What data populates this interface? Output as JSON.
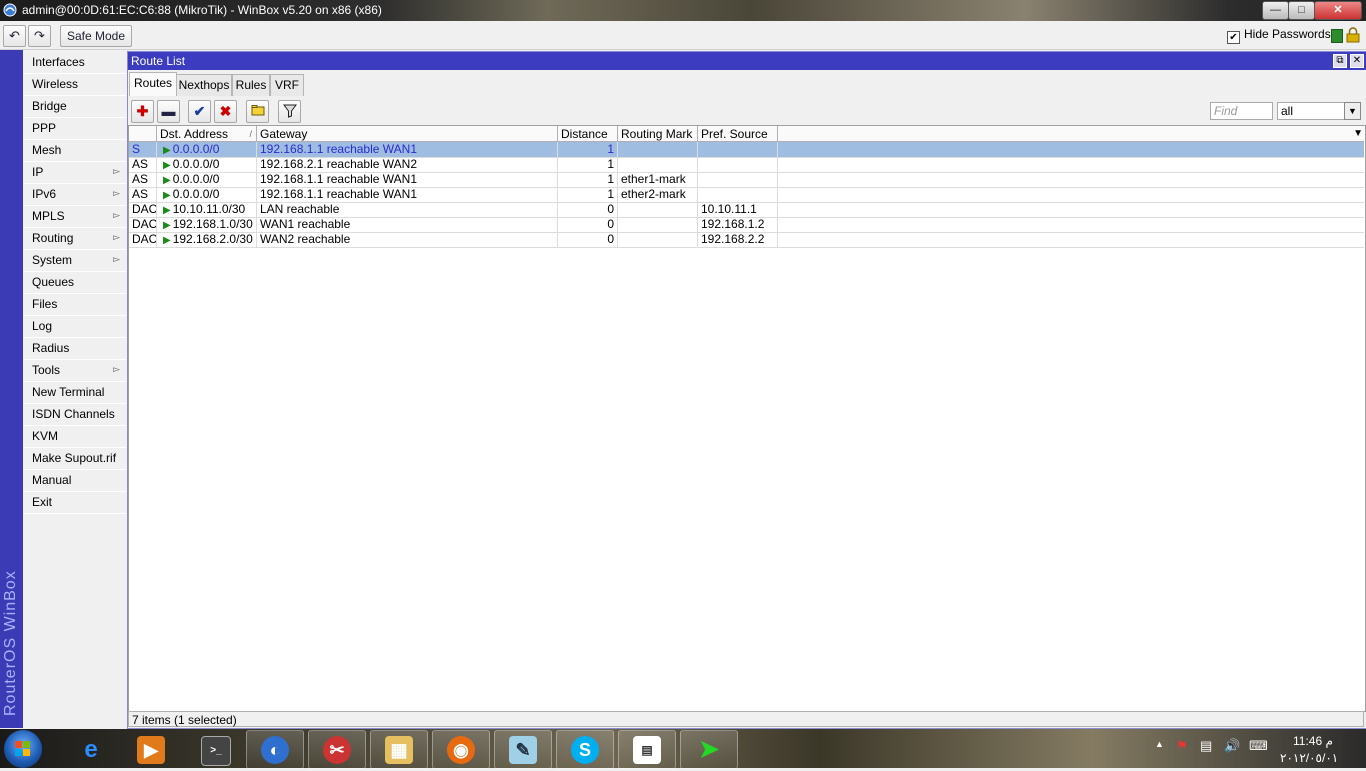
{
  "window": {
    "title": "admin@00:0D:61:EC:C6:88 (MikroTik) - WinBox v5.20 on x86 (x86)",
    "min_glyph": "—",
    "max_glyph": "□",
    "close_glyph": "✕"
  },
  "toolbar": {
    "undo_glyph": "↶",
    "redo_glyph": "↷",
    "safe_mode": "Safe Mode",
    "hide_passwords_label": "Hide Passwords",
    "hide_passwords_checked": "✔"
  },
  "sidebar": {
    "brand": "RouterOS WinBox",
    "items": [
      {
        "label": "Interfaces"
      },
      {
        "label": "Wireless"
      },
      {
        "label": "Bridge"
      },
      {
        "label": "PPP"
      },
      {
        "label": "Mesh"
      },
      {
        "label": "IP"
      },
      {
        "label": "IPv6"
      },
      {
        "label": "MPLS"
      },
      {
        "label": "Routing"
      },
      {
        "label": "System"
      },
      {
        "label": "Queues"
      },
      {
        "label": "Files"
      },
      {
        "label": "Log"
      },
      {
        "label": "Radius"
      },
      {
        "label": "Tools"
      },
      {
        "label": "New Terminal"
      },
      {
        "label": "ISDN Channels"
      },
      {
        "label": "KVM"
      },
      {
        "label": "Make Supout.rif"
      },
      {
        "label": "Manual"
      },
      {
        "label": "Exit"
      }
    ]
  },
  "route_list": {
    "title": "Route List",
    "tabs": [
      "Routes",
      "Nexthops",
      "Rules",
      "VRF"
    ],
    "find_placeholder": "Find",
    "scope_value": "all",
    "columns": [
      "",
      "Dst. Address",
      "Gateway",
      "Distance",
      "Routing Mark",
      "Pref. Source"
    ],
    "rows": [
      {
        "flags": "S",
        "dst": "0.0.0.0/0",
        "gateway": "192.168.1.1 reachable WAN1",
        "distance": "1",
        "mark": "",
        "pref": ""
      },
      {
        "flags": "AS",
        "dst": "0.0.0.0/0",
        "gateway": "192.168.2.1 reachable WAN2",
        "distance": "1",
        "mark": "",
        "pref": ""
      },
      {
        "flags": "AS",
        "dst": "0.0.0.0/0",
        "gateway": "192.168.1.1 reachable WAN1",
        "distance": "1",
        "mark": "ether1-mark",
        "pref": ""
      },
      {
        "flags": "AS",
        "dst": "0.0.0.0/0",
        "gateway": "192.168.1.1 reachable WAN1",
        "distance": "1",
        "mark": "ether2-mark",
        "pref": ""
      },
      {
        "flags": "DAC",
        "dst": "10.10.11.0/30",
        "gateway": "LAN reachable",
        "distance": "0",
        "mark": "",
        "pref": "10.10.11.1"
      },
      {
        "flags": "DAC",
        "dst": "192.168.1.0/30",
        "gateway": "WAN1 reachable",
        "distance": "0",
        "mark": "",
        "pref": "192.168.1.2"
      },
      {
        "flags": "DAC",
        "dst": "192.168.2.0/30",
        "gateway": "WAN2 reachable",
        "distance": "0",
        "mark": "",
        "pref": "192.168.2.2"
      }
    ],
    "selected_row": 0,
    "status": "7 items (1 selected)"
  },
  "taskbar": {
    "time": "11:46 م",
    "date": "٢٠١٢/٠٥/٠١"
  }
}
